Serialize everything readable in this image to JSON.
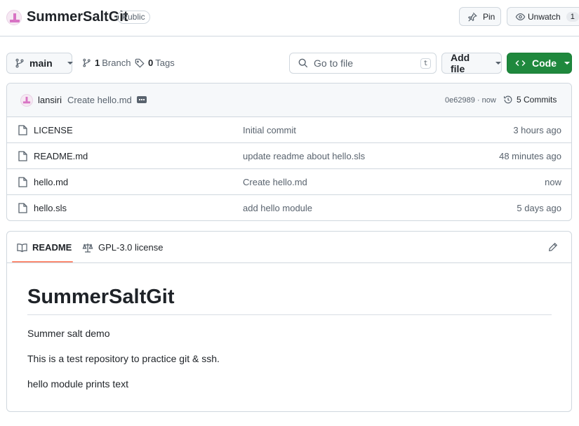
{
  "repo": {
    "name": "SummerSaltGit",
    "visibility": "Public",
    "pin_label": "Pin",
    "watch_label": "Unwatch",
    "watch_count": "1"
  },
  "toolbar": {
    "branch": "main",
    "branches_count": "1",
    "branches_label": "Branch",
    "tags_count": "0",
    "tags_label": "Tags",
    "search_placeholder": "Go to file",
    "search_shortcut": "t",
    "add_file_label": "Add file",
    "code_label": "Code"
  },
  "latest_commit": {
    "author": "lansiri",
    "message": "Create hello.md",
    "hash_time": "0e62989 · now",
    "commits_label": "5 Commits"
  },
  "files": [
    {
      "name": "LICENSE",
      "message": "Initial commit",
      "date": "3 hours ago"
    },
    {
      "name": "README.md",
      "message": "update readme about hello.sls",
      "date": "48 minutes ago"
    },
    {
      "name": "hello.md",
      "message": "Create hello.md",
      "date": "now"
    },
    {
      "name": "hello.sls",
      "message": "add hello module",
      "date": "5 days ago"
    }
  ],
  "readme": {
    "tabs": [
      "README",
      "GPL-3.0 license"
    ],
    "heading": "SummerSaltGit",
    "paragraphs": [
      "Summer salt demo",
      "This is a test repository to practice git & ssh.",
      "hello module prints text"
    ]
  },
  "colors": {
    "accent_green": "#1f883d",
    "border": "#d0d7de",
    "muted_text": "#59636e",
    "tab_underline": "#fd8c73"
  },
  "icons": [
    "identicon-avatar",
    "pin-icon",
    "eye-icon",
    "branch-icon",
    "tag-icon",
    "search-icon",
    "code-icon",
    "history-icon",
    "file-icon",
    "book-icon",
    "law-icon",
    "pencil-icon"
  ]
}
